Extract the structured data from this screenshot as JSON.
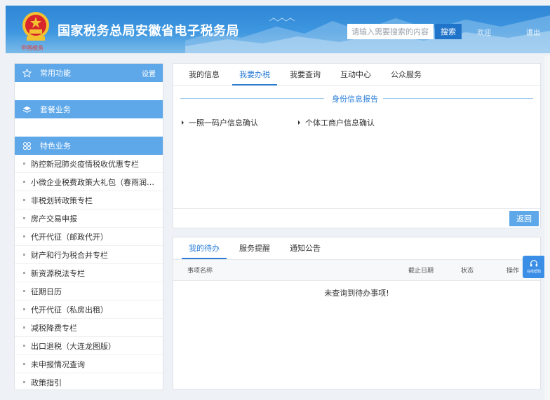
{
  "header": {
    "title": "国家税务总局安徽省电子税务局",
    "emblem_text": "中国税务",
    "search_placeholder": "请输入需要搜索的内容",
    "search_button": "搜索",
    "welcome": "欢迎",
    "logout": "退出",
    "colors": {
      "bar": "#3e97e0",
      "accent": "#1f73c9"
    }
  },
  "sidebar": {
    "common": {
      "label": "常用功能",
      "extra": "设置",
      "icon": "star-icon"
    },
    "packages": {
      "label": "套餐业务",
      "icon": "layers-icon"
    },
    "featured": {
      "label": "特色业务",
      "icon": "grid-icon"
    },
    "items": [
      "防控新冠肺炎疫情税收优惠专栏",
      "小微企业税费政策大礼包（春雨润苗）",
      "非税划转政策专栏",
      "房产交易申报",
      "代开代征（邮政代开）",
      "财产和行为税合并专栏",
      "新资源税法专栏",
      "征期日历",
      "代开代征（私房出租）",
      "减税降费专栏",
      "出口退税（大连龙图版）",
      "未申报情况查询",
      "政策指引"
    ]
  },
  "top_panel": {
    "tabs": [
      "我的信息",
      "我要办税",
      "我要查询",
      "互动中心",
      "公众服务"
    ],
    "active_tab": 1,
    "section_title": "身份信息报告",
    "items": [
      "一照一码户信息确认",
      "个体工商户信息确认"
    ],
    "back_button": "返回"
  },
  "bottom_panel": {
    "tabs": [
      "我的待办",
      "服务提醒",
      "通知公告"
    ],
    "active_tab": 0,
    "columns": {
      "name": "事项名称",
      "deadline": "截止日期",
      "status": "状态",
      "action": "操作"
    },
    "empty_message": "未查询到待办事项!"
  },
  "support": {
    "label": "在线帮助",
    "icon": "headset-icon"
  }
}
